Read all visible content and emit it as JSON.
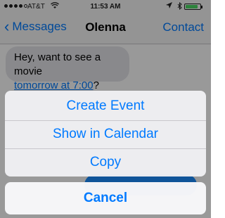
{
  "status_bar": {
    "carrier": "AT&T",
    "time": "11:53 AM",
    "signal_bars_filled": 4,
    "signal_bars_total": 5,
    "battery_level": 0.85,
    "icons": [
      "wifi-icon",
      "location-icon",
      "bluetooth-icon",
      "battery-icon"
    ]
  },
  "nav": {
    "back_label": "Messages",
    "title": "Olenna",
    "right_label": "Contact"
  },
  "message": {
    "text_before": "Hey, want to see a movie",
    "link_text": "tomorrow at 7:00",
    "text_after": "?"
  },
  "action_sheet": {
    "actions": [
      "Create Event",
      "Show in Calendar",
      "Copy"
    ],
    "cancel_label": "Cancel"
  },
  "colors": {
    "accent": "#007aff",
    "bubble_gray": "#e5e5ea",
    "battery_green": "#4cd964"
  }
}
